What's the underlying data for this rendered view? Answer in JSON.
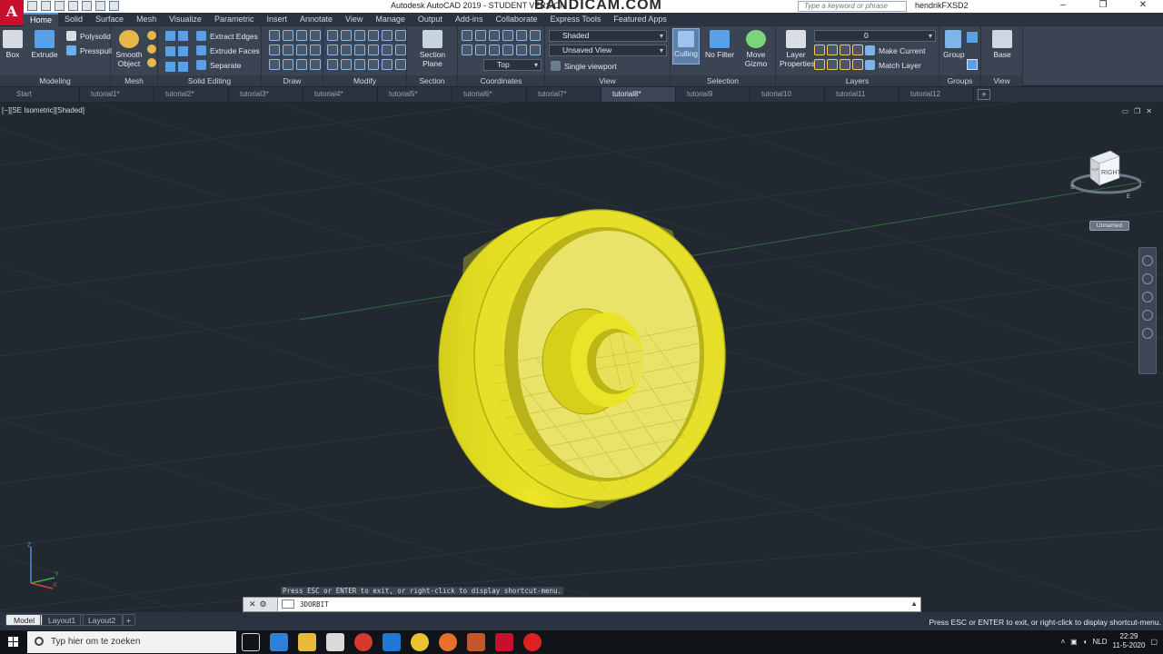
{
  "titlebar": {
    "app_logo": "A",
    "app_title": "Autodesk AutoCAD 2019 - STUDENT VERSION",
    "watermark": "BANDICAM.COM",
    "search_placeholder": "Type a keyword or phrase",
    "user": "hendrikFXSD2"
  },
  "ribbon_tabs": [
    "Home",
    "Solid",
    "Surface",
    "Mesh",
    "Visualize",
    "Parametric",
    "Insert",
    "Annotate",
    "View",
    "Manage",
    "Output",
    "Add-ins",
    "Collaborate",
    "Express Tools",
    "Featured Apps"
  ],
  "ribbon": {
    "modeling": {
      "title": "Modeling",
      "box": "Box",
      "extrude": "Extrude",
      "polysolid": "Polysolid",
      "presspull": "Presspull"
    },
    "mesh": {
      "title": "Mesh",
      "smooth_object": "Smooth Object"
    },
    "solid_editing": {
      "title": "Solid Editing",
      "extract_edges": "Extract Edges",
      "extrude_faces": "Extrude Faces",
      "separate": "Separate"
    },
    "draw": {
      "title": "Draw"
    },
    "modify": {
      "title": "Modify"
    },
    "section": {
      "title": "Section",
      "section_plane": "Section Plane"
    },
    "coordinates": {
      "title": "Coordinates",
      "ucs_value": "Top"
    },
    "view": {
      "title": "View",
      "visual_style": "Shaded",
      "named_view": "Unsaved View",
      "viewport": "Single viewport"
    },
    "selection": {
      "title": "Selection",
      "culling": "Culling",
      "no_filter": "No Filter",
      "move_gizmo": "Move Gizmo"
    },
    "layers": {
      "title": "Layers",
      "layer_properties": "Layer Properties",
      "current_layer": "0",
      "make_current": "Make Current",
      "match_layer": "Match Layer"
    },
    "groups": {
      "title": "Groups",
      "group": "Group"
    },
    "view2": {
      "title": "View",
      "base": "Base"
    }
  },
  "doc_tabs": [
    "Start",
    "tutorial1*",
    "tutorial2*",
    "tutorial3*",
    "tutorial4*",
    "tutorial5*",
    "tutorial6*",
    "tutorial7*",
    "tutorial8*",
    "tutorial9",
    "tutorial10",
    "tutorial11",
    "tutorial12"
  ],
  "active_doc_tab": "tutorial8*",
  "viewport": {
    "label": "[−][SE Isometric][Shaded]",
    "viewcube_face": "RIGHT",
    "viewcube_face_side": "TOP",
    "compass": {
      "s": "S",
      "e": "E"
    },
    "ucs_name": "Unnamed",
    "axis_labels": {
      "z": "Z",
      "y": "Y",
      "x": "X"
    }
  },
  "command": {
    "hint": "Press ESC or ENTER to exit, or right-click to display shortcut-menu.",
    "current": "3DORBIT"
  },
  "layout_tabs": [
    "Model",
    "Layout1",
    "Layout2"
  ],
  "status_message": "Press ESC or ENTER to exit, or right-click to display shortcut-menu.",
  "taskbar": {
    "search_placeholder": "Typ hier om te zoeken",
    "language": "NLD",
    "time": "22:29",
    "date": "11-5-2020"
  },
  "colors": {
    "model": "#e6e02a",
    "model_shadow": "#b7b212",
    "background": "#212830",
    "accent": "#4d90d8"
  }
}
